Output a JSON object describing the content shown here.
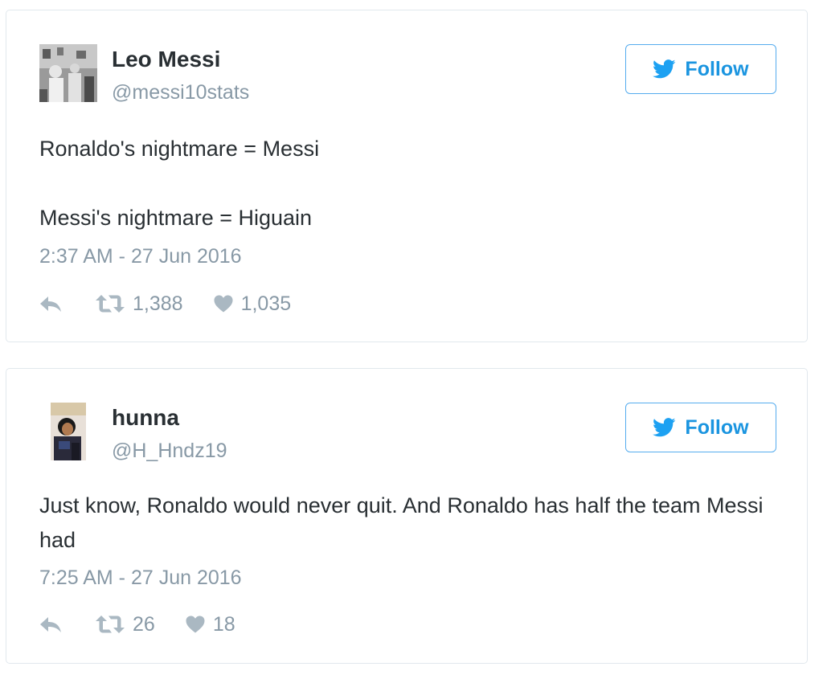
{
  "tweets": [
    {
      "display_name": "Leo Messi",
      "handle": "@messi10stats",
      "follow_label": "Follow",
      "text_lines": [
        "Ronaldo's nightmare = Messi",
        "Messi's nightmare = Higuain"
      ],
      "timestamp": "2:37 AM - 27 Jun 2016",
      "retweets": "1,388",
      "likes": "1,035",
      "avatar_icon": "messi-photo-avatar"
    },
    {
      "display_name": "hunna",
      "handle": "@H_Hndz19",
      "follow_label": "Follow",
      "text_lines": [
        "Just know, Ronaldo would never quit. And Ronaldo has half the team Messi had"
      ],
      "timestamp": "7:25 AM - 27 Jun 2016",
      "retweets": "26",
      "likes": "18",
      "avatar_icon": "user-photo-avatar"
    }
  ],
  "icons": {
    "follow": "twitter-bird-icon",
    "reply": "reply-arrow-icon",
    "retweet": "retweet-icon",
    "like": "heart-icon"
  },
  "colors": {
    "accent": "#1b95e0",
    "button_border": "#55acee",
    "text": "#292f33",
    "muted": "#8899a6",
    "icon": "#aab8c2",
    "card_border": "#e1e8ed"
  }
}
